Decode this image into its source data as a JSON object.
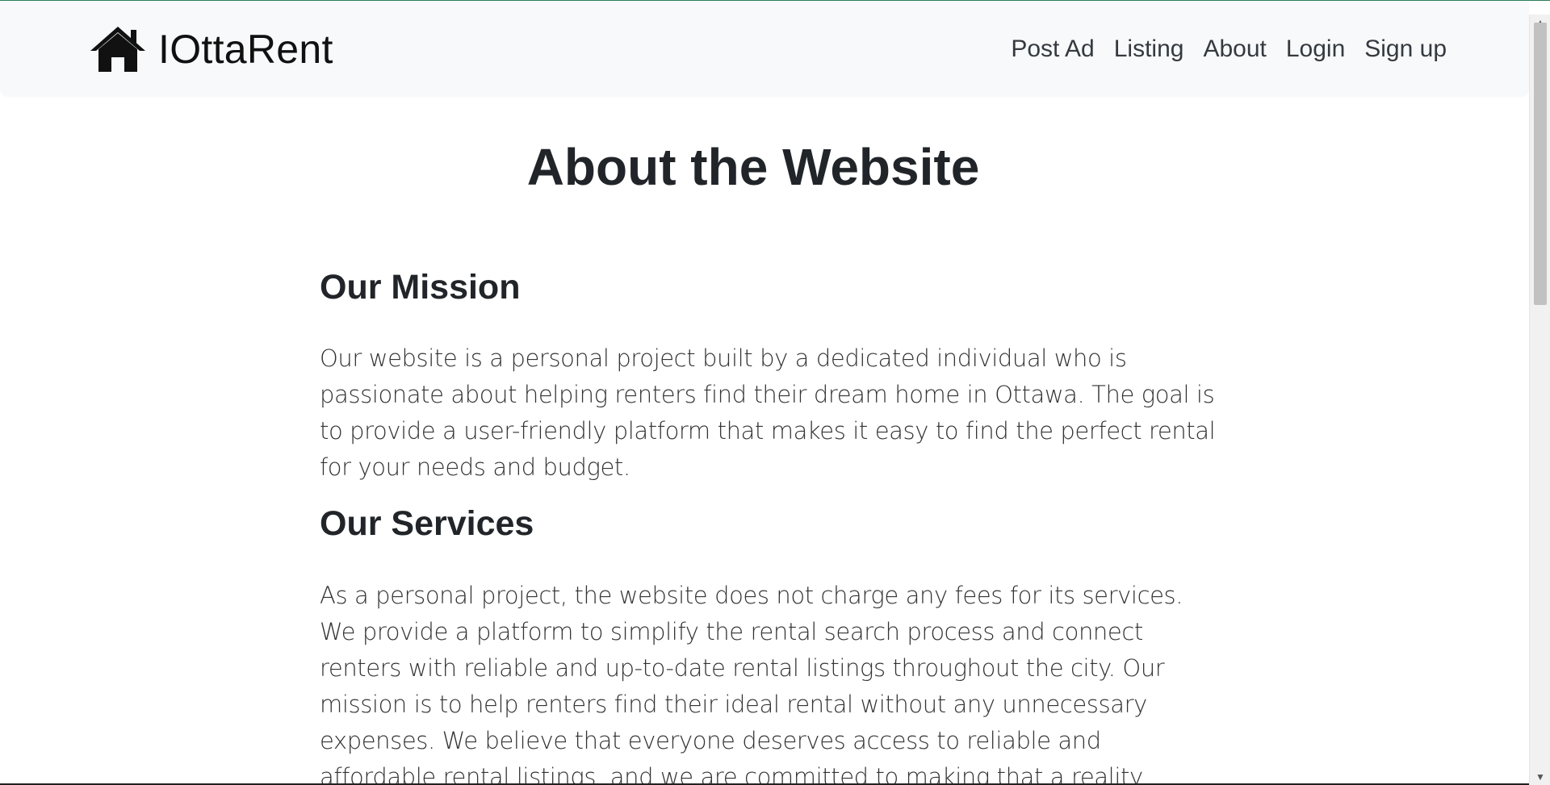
{
  "header": {
    "brand_name": "IOttaRent",
    "brand_icon": "home-icon",
    "nav": [
      {
        "label": "Post Ad"
      },
      {
        "label": "Listing"
      },
      {
        "label": "About"
      },
      {
        "label": "Login"
      },
      {
        "label": "Sign up"
      }
    ]
  },
  "main": {
    "title": "About the Website",
    "sections": [
      {
        "heading": "Our Mission",
        "body": "Our website is a personal project built by a dedicated individual who is passionate about helping renters find their dream home in Ottawa. The goal is to provide a user-friendly platform that makes it easy to find the perfect rental for your needs and budget."
      },
      {
        "heading": "Our Services",
        "body": "As a personal project, the website does not charge any fees for its services. We provide a platform to simplify the rental search process and connect renters with reliable and up-to-date rental listings throughout the city. Our mission is to help renters find their ideal rental without any unnecessary expenses. We believe that everyone deserves access to reliable and affordable rental listings, and we are committed to making that a reality."
      }
    ]
  },
  "colors": {
    "navbar_bg": "#f8f9fa",
    "text_dark": "#212529",
    "nav_link": "#343a40",
    "accent_top": "#2e7d5b"
  }
}
